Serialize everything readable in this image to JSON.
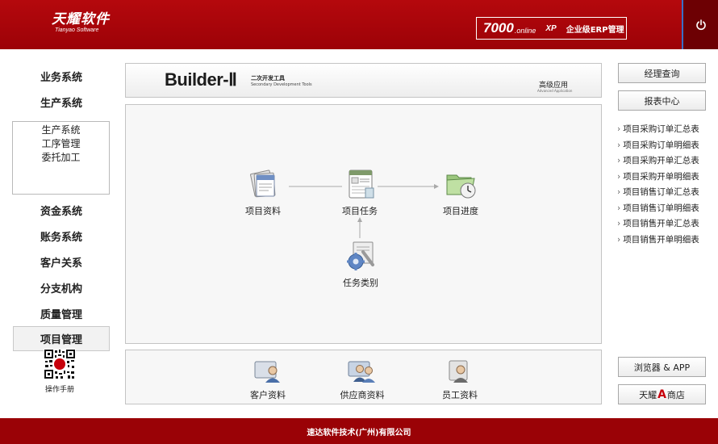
{
  "header": {
    "logo_title": "天耀软件",
    "logo_subtitle": "Tianyao Software",
    "badge_number": "7000",
    "badge_online": ".online",
    "badge_xp": "XP",
    "badge_text": "企业级ERP管理",
    "power_icon": "power-icon"
  },
  "sidebar": {
    "items_top": [
      {
        "label": "业务系统"
      },
      {
        "label": "生产系统"
      }
    ],
    "sub_items": [
      {
        "label": "生产系统"
      },
      {
        "label": "工序管理"
      },
      {
        "label": "委托加工"
      }
    ],
    "items_bottom": [
      {
        "label": "资金系统"
      },
      {
        "label": "账务系统"
      },
      {
        "label": "客户关系"
      },
      {
        "label": "分支机构"
      },
      {
        "label": "质量管理"
      },
      {
        "label": "项目管理",
        "active": true
      }
    ],
    "qr_label": "操作手册"
  },
  "banner": {
    "logo": "Builder-Ⅱ",
    "subtitle_cn": "二次开发工具",
    "subtitle_en": "Secondary Development Tools",
    "advanced_cn": "高级应用",
    "advanced_en": "Advanced Application"
  },
  "workflow": {
    "nodes": [
      {
        "label": "项目资料",
        "icon": "document-stack-icon"
      },
      {
        "label": "项目任务",
        "icon": "task-form-icon"
      },
      {
        "label": "项目进度",
        "icon": "folder-clock-icon"
      },
      {
        "label": "任务类别",
        "icon": "gear-tools-icon"
      }
    ]
  },
  "bottom_strip": {
    "items": [
      {
        "label": "客户资料",
        "icon": "customer-icon"
      },
      {
        "label": "供应商资料",
        "icon": "supplier-icon"
      },
      {
        "label": "员工资料",
        "icon": "employee-icon"
      }
    ]
  },
  "right": {
    "manager_query": "经理查询",
    "report_center": "报表中心",
    "reports": [
      "项目采购订单汇总表",
      "项目采购订单明细表",
      "项目采购开单汇总表",
      "项目采购开单明细表",
      "项目销售订单汇总表",
      "项目销售订单明细表",
      "项目销售开单汇总表",
      "项目销售开单明细表"
    ],
    "chevron": "›",
    "browser_app": "浏览器 & APP",
    "store_pre": "天耀",
    "store_a": "A",
    "store_post": "商店"
  },
  "footer": {
    "company": "速达软件技术(广州)有限公司"
  },
  "colors": {
    "header_red": "#b5080d",
    "footer_red": "#9a0206",
    "power_bg": "#6d0003",
    "accent_blue": "#3a6fc7"
  }
}
